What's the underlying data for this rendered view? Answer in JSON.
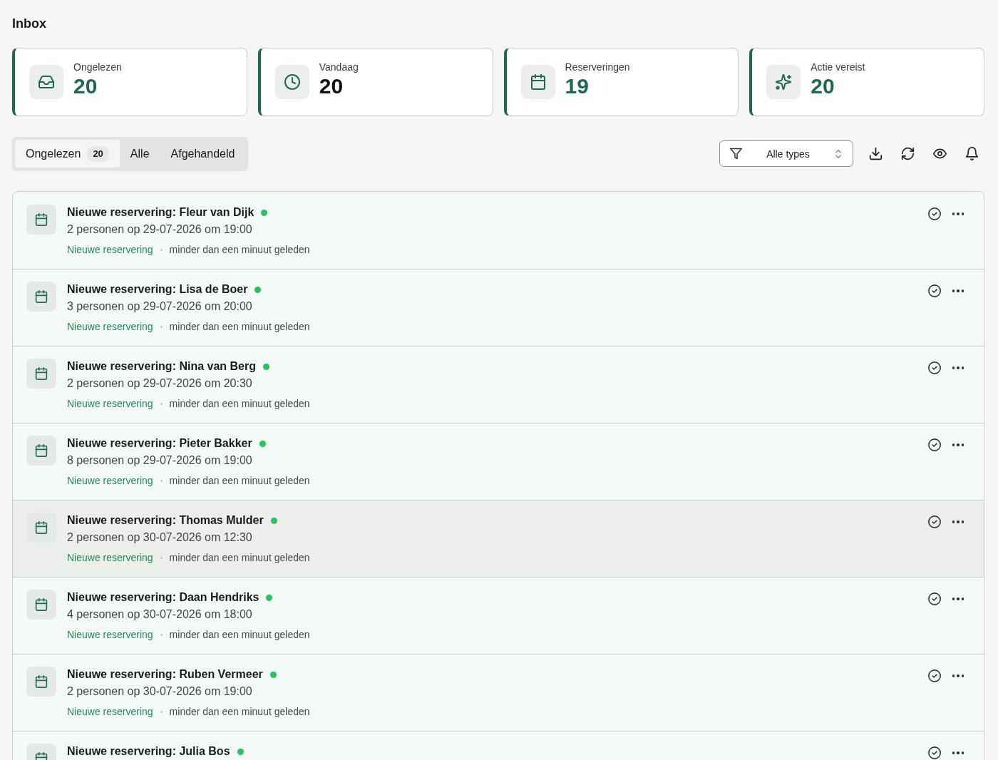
{
  "title": "Inbox",
  "stats": [
    {
      "kind": "unread",
      "label": "Ongelezen",
      "value": "20",
      "color": "#1d6b4c"
    },
    {
      "kind": "today",
      "label": "Vandaag",
      "value": "20",
      "color": "#111111"
    },
    {
      "kind": "reservations",
      "label": "Reserveringen",
      "value": "19",
      "color": "#1d6b4c"
    },
    {
      "kind": "action",
      "label": "Actie vereist",
      "value": "20",
      "color": "#1d6b4c"
    }
  ],
  "tabs": [
    {
      "label": "Ongelezen",
      "count": "20",
      "selected": true
    },
    {
      "label": "Alle",
      "selected": false
    },
    {
      "label": "Afgehandeld",
      "selected": false
    }
  ],
  "filter": {
    "value": "Alle types"
  },
  "rows": [
    {
      "title": "Nieuwe reservering: Fleur van Dijk",
      "unread": true,
      "subtitle": "2 personen op 29-07-2026 om 19:00",
      "type_label": "Nieuwe reservering",
      "time": "minder dan een minuut geleden",
      "selected": false
    },
    {
      "title": "Nieuwe reservering: Lisa de Boer",
      "unread": true,
      "subtitle": "3 personen op 29-07-2026 om 20:00",
      "type_label": "Nieuwe reservering",
      "time": "minder dan een minuut geleden",
      "selected": false
    },
    {
      "title": "Nieuwe reservering: Nina van Berg",
      "unread": true,
      "subtitle": "2 personen op 29-07-2026 om 20:30",
      "type_label": "Nieuwe reservering",
      "time": "minder dan een minuut geleden",
      "selected": false
    },
    {
      "title": "Nieuwe reservering: Pieter Bakker",
      "unread": true,
      "subtitle": "8 personen op 29-07-2026 om 19:00",
      "type_label": "Nieuwe reservering",
      "time": "minder dan een minuut geleden",
      "selected": false
    },
    {
      "title": "Nieuwe reservering: Thomas Mulder",
      "unread": true,
      "subtitle": "2 personen op 30-07-2026 om 12:30",
      "type_label": "Nieuwe reservering",
      "time": "minder dan een minuut geleden",
      "selected": true
    },
    {
      "title": "Nieuwe reservering: Daan Hendriks",
      "unread": true,
      "subtitle": "4 personen op 30-07-2026 om 18:00",
      "type_label": "Nieuwe reservering",
      "time": "minder dan een minuut geleden",
      "selected": false
    },
    {
      "title": "Nieuwe reservering: Ruben Vermeer",
      "unread": true,
      "subtitle": "2 personen op 30-07-2026 om 19:00",
      "type_label": "Nieuwe reservering",
      "time": "minder dan een minuut geleden",
      "selected": false
    },
    {
      "title": "Nieuwe reservering: Julia Bos",
      "unread": true,
      "selected": false
    }
  ]
}
